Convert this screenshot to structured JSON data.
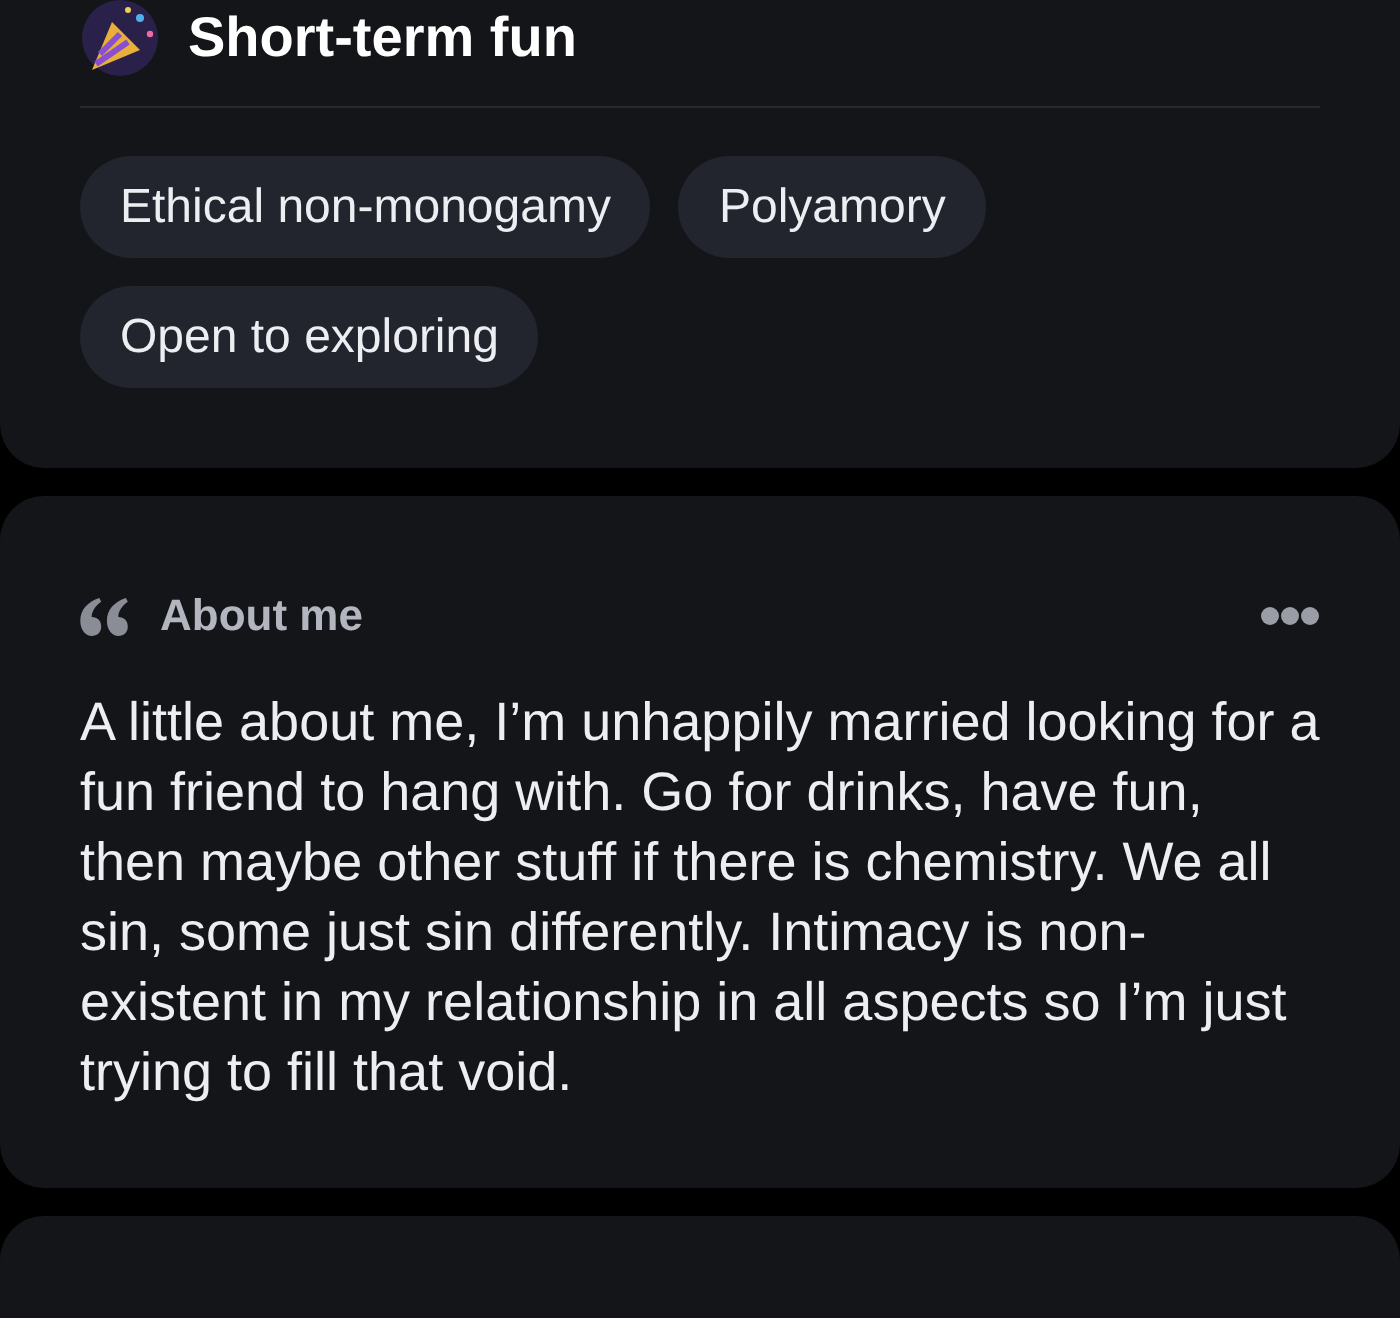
{
  "looking_for": {
    "title": "Short-term fun",
    "tags": [
      {
        "label": "Ethical non-monogamy"
      },
      {
        "label": "Polyamory"
      },
      {
        "label": "Open to exploring"
      }
    ]
  },
  "about": {
    "title": "About me",
    "text": "A little about me, I’m unhappily married looking for a fun friend to hang with.  Go for drinks, have fun, then maybe other stuff if there is chemistry. We all sin, some just sin differently.  Intimacy is non-existent in my relationship in all aspects so I’m just trying to fill that void."
  }
}
